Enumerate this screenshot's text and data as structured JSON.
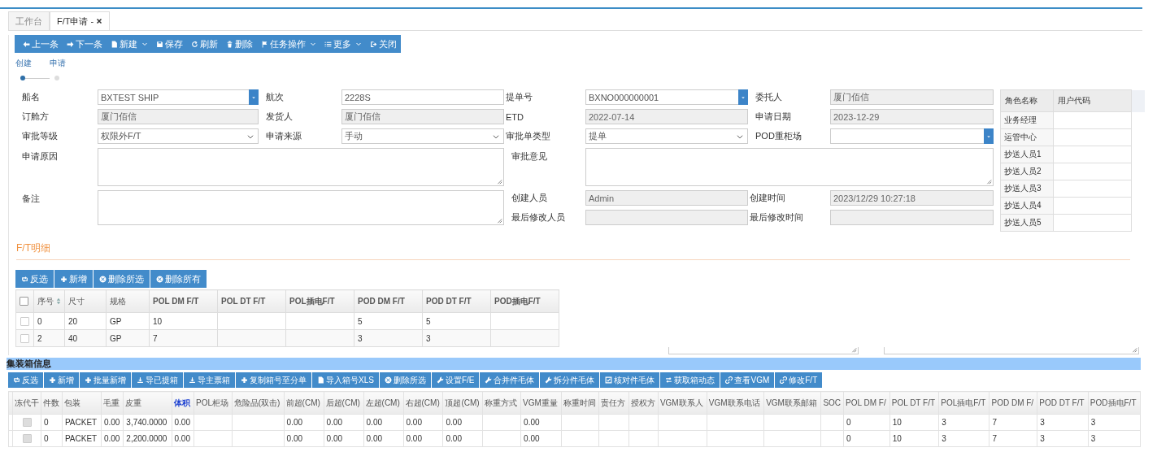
{
  "tabs": [
    {
      "label": "工作台",
      "selected": false,
      "closable": false
    },
    {
      "label": "F/T申请 -",
      "selected": true,
      "closable": true
    }
  ],
  "toolbar": [
    {
      "label": "上一条",
      "dropdown": false
    },
    {
      "label": "下一条",
      "dropdown": false
    },
    {
      "label": "新建",
      "dropdown": true
    },
    {
      "label": "保存",
      "dropdown": false
    },
    {
      "label": "刷新",
      "dropdown": false
    },
    {
      "label": "删除",
      "dropdown": false
    },
    {
      "label": "任务操作",
      "dropdown": true
    },
    {
      "label": "更多",
      "dropdown": true
    },
    {
      "label": "关闭",
      "dropdown": false
    }
  ],
  "steps": [
    {
      "label": "创建",
      "selected": true
    },
    {
      "label": "申请",
      "selected": false
    }
  ],
  "form": [
    {
      "label": "船名",
      "value": "BXTEST SHIP",
      "kind": "combo",
      "disabled": false
    },
    {
      "label": "航次",
      "value": "2228S",
      "kind": "text",
      "disabled": false
    },
    {
      "label": "提单号",
      "value": "BXNO000000001",
      "kind": "combo",
      "disabled": false
    },
    {
      "label": "委托人",
      "value": "厦门佰信",
      "kind": "text",
      "disabled": true
    },
    {
      "label": "订舱方",
      "value": "厦门佰信",
      "kind": "text",
      "disabled": true
    },
    {
      "label": "发货人",
      "value": "厦门佰信",
      "kind": "text",
      "disabled": true
    },
    {
      "label": "ETD",
      "value": "2022-07-14",
      "kind": "text",
      "disabled": true
    },
    {
      "label": "申请日期",
      "value": "2023-12-29",
      "kind": "text",
      "disabled": true
    },
    {
      "label": "审批等级",
      "value": "权限外F/T",
      "kind": "select",
      "disabled": false
    },
    {
      "label": "申请来源",
      "value": "手动",
      "kind": "select",
      "disabled": false
    },
    {
      "label": "审批单类型",
      "value": "提单",
      "kind": "select",
      "disabled": false
    },
    {
      "label": "POD重柜场",
      "kind": "combo",
      "disabled": false
    },
    {
      "label": "申请原因",
      "kind": "textarea",
      "disabled": false
    },
    {
      "label": "审批意见",
      "kind": "textarea",
      "disabled": false
    },
    {
      "label": "备注",
      "kind": "textarea",
      "disabled": false
    },
    {
      "label": "创建人员",
      "value": "Admin",
      "kind": "text",
      "disabled": true
    },
    {
      "label": "创建时间",
      "value": "2023/12/29 10:27:18",
      "kind": "text",
      "disabled": true
    },
    {
      "label": "最后修改人员",
      "kind": "text",
      "disabled": true
    },
    {
      "label": "最后修改时间",
      "kind": "text",
      "disabled": true
    }
  ],
  "roles": {
    "columns": [
      "角色名称",
      "用户代码"
    ],
    "rows": [
      "业务经理",
      "运管中心",
      "抄送人员1",
      "抄送人员2",
      "抄送人员3",
      "抄送人员4",
      "抄送人员5"
    ]
  },
  "ft_detail": {
    "title": "F/T明细",
    "buttons": [
      "反选",
      "新增",
      "删除所选",
      "删除所有"
    ],
    "select_all": false,
    "columns": [
      "序号",
      "尺寸",
      "规格",
      "POL DM F/T",
      "POL DT F/T",
      "POL插电F/T",
      "POD DM F/T",
      "POD DT F/T",
      "POD插电F/T"
    ],
    "rows": [
      {
        "checked": false,
        "cells": [
          "0",
          "20",
          "GP",
          "10",
          null,
          null,
          "5",
          "5",
          null
        ]
      },
      {
        "checked": false,
        "cells": [
          "2",
          "40",
          "GP",
          "7",
          null,
          null,
          "3",
          "3",
          null
        ]
      }
    ]
  },
  "containers": {
    "title": "集装箱信息",
    "buttons": [
      "反选",
      "新增",
      "批量新增",
      "导已提箱",
      "导主票箱",
      "复制箱号至分单",
      "导入箱号XLS",
      "删除所选",
      "设置F/E",
      "合并件毛体",
      "拆分件毛体",
      "核对件毛体",
      "获取箱动态",
      "查看VGM",
      "修改F/T"
    ],
    "columns": [
      {
        "label": "冻代干",
        "highlighted": false
      },
      {
        "label": "件数",
        "highlighted": false
      },
      {
        "label": "包装",
        "highlighted": false
      },
      {
        "label": "毛重",
        "highlighted": false
      },
      {
        "label": "皮重",
        "highlighted": false
      },
      {
        "label": "体积",
        "highlighted": true
      },
      {
        "label": "POL柜场",
        "highlighted": false
      },
      {
        "label": "危险品(双击)",
        "highlighted": false
      },
      {
        "label": "前超(CM)",
        "highlighted": false
      },
      {
        "label": "后超(CM)",
        "highlighted": false
      },
      {
        "label": "左超(CM)",
        "highlighted": false
      },
      {
        "label": "右超(CM)",
        "highlighted": false
      },
      {
        "label": "顶超(CM)",
        "highlighted": false
      },
      {
        "label": "称重方式",
        "highlighted": false
      },
      {
        "label": "VGM重量",
        "highlighted": false
      },
      {
        "label": "称重时间",
        "highlighted": false
      },
      {
        "label": "责任方",
        "highlighted": false
      },
      {
        "label": "授权方",
        "highlighted": false
      },
      {
        "label": "VGM联系人",
        "highlighted": false
      },
      {
        "label": "VGM联系电话",
        "highlighted": false
      },
      {
        "label": "VGM联系邮箱",
        "highlighted": false
      },
      {
        "label": "SOC",
        "highlighted": false
      },
      {
        "label": "POL DM F/",
        "highlighted": false
      },
      {
        "label": "POL DT F/T",
        "highlighted": false
      },
      {
        "label": "POL插电F/T",
        "highlighted": false
      },
      {
        "label": "POD DM F/",
        "highlighted": false
      },
      {
        "label": "POD DT F/T",
        "highlighted": false
      },
      {
        "label": "POD插电F/T",
        "highlighted": false
      }
    ],
    "rows": [
      {
        "reefer_as_dry": false,
        "disabled": true,
        "cells": [
          "",
          "0",
          "PACKET",
          "0.00",
          "3,740.0000",
          "0.00",
          null,
          null,
          "0.00",
          "0.00",
          "0.00",
          "0.00",
          "0.00",
          null,
          "0.00",
          null,
          null,
          null,
          null,
          null,
          null,
          null,
          "0",
          "10",
          "3",
          "7",
          "3",
          "3"
        ]
      },
      {
        "reefer_as_dry": false,
        "disabled": true,
        "cells": [
          "",
          "0",
          "PACKET",
          "0.00",
          "2,200.0000",
          "0.00",
          null,
          null,
          "0.00",
          "0.00",
          "0.00",
          "0.00",
          "0.00",
          null,
          "0.00",
          null,
          null,
          null,
          null,
          null,
          null,
          null,
          "0",
          "10",
          "3",
          "7",
          "3",
          "3"
        ]
      }
    ]
  }
}
